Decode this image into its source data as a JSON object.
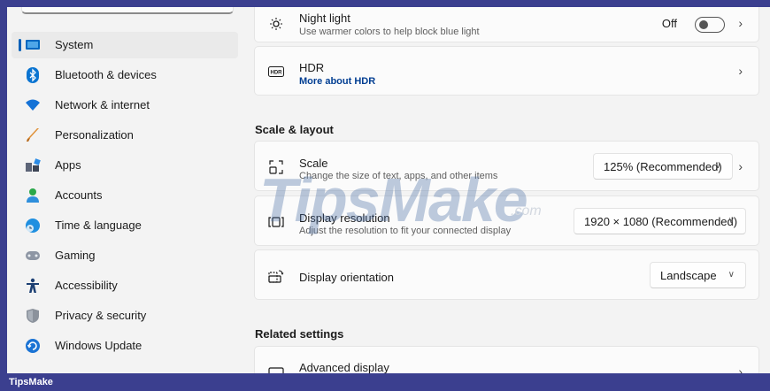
{
  "sidebar": {
    "items": [
      {
        "label": "System",
        "icon": "system-monitor-icon",
        "active": true
      },
      {
        "label": "Bluetooth & devices",
        "icon": "bluetooth-icon"
      },
      {
        "label": "Network & internet",
        "icon": "wifi-icon"
      },
      {
        "label": "Personalization",
        "icon": "brush-icon"
      },
      {
        "label": "Apps",
        "icon": "apps-icon"
      },
      {
        "label": "Accounts",
        "icon": "person-icon"
      },
      {
        "label": "Time & language",
        "icon": "globe-clock-icon"
      },
      {
        "label": "Gaming",
        "icon": "gamepad-icon"
      },
      {
        "label": "Accessibility",
        "icon": "accessibility-icon"
      },
      {
        "label": "Privacy & security",
        "icon": "shield-icon"
      },
      {
        "label": "Windows Update",
        "icon": "update-icon"
      }
    ]
  },
  "content": {
    "night_light": {
      "title": "Night light",
      "subtitle": "Use warmer colors to help block blue light",
      "state": "Off"
    },
    "hdr": {
      "title": "HDR",
      "link": "More about HDR",
      "badge": "HDR"
    },
    "scale_layout": {
      "header": "Scale & layout",
      "scale": {
        "title": "Scale",
        "subtitle": "Change the size of text, apps, and other items",
        "value": "125% (Recommended)"
      },
      "resolution": {
        "title": "Display resolution",
        "subtitle": "Adjust the resolution to fit your connected display",
        "value": "1920 × 1080 (Recommended)"
      },
      "orientation": {
        "title": "Display orientation",
        "value": "Landscape"
      }
    },
    "related": {
      "header": "Related settings",
      "advanced": {
        "title": "Advanced display"
      }
    }
  },
  "watermark": {
    "text": "TipsMake",
    "suffix": ".com"
  },
  "footer": {
    "brand": "TipsMake"
  },
  "colors": {
    "accent": "#005fb8",
    "frame": "#3b3f8f",
    "background": "#f3f3f3",
    "card": "#fbfbfb"
  }
}
